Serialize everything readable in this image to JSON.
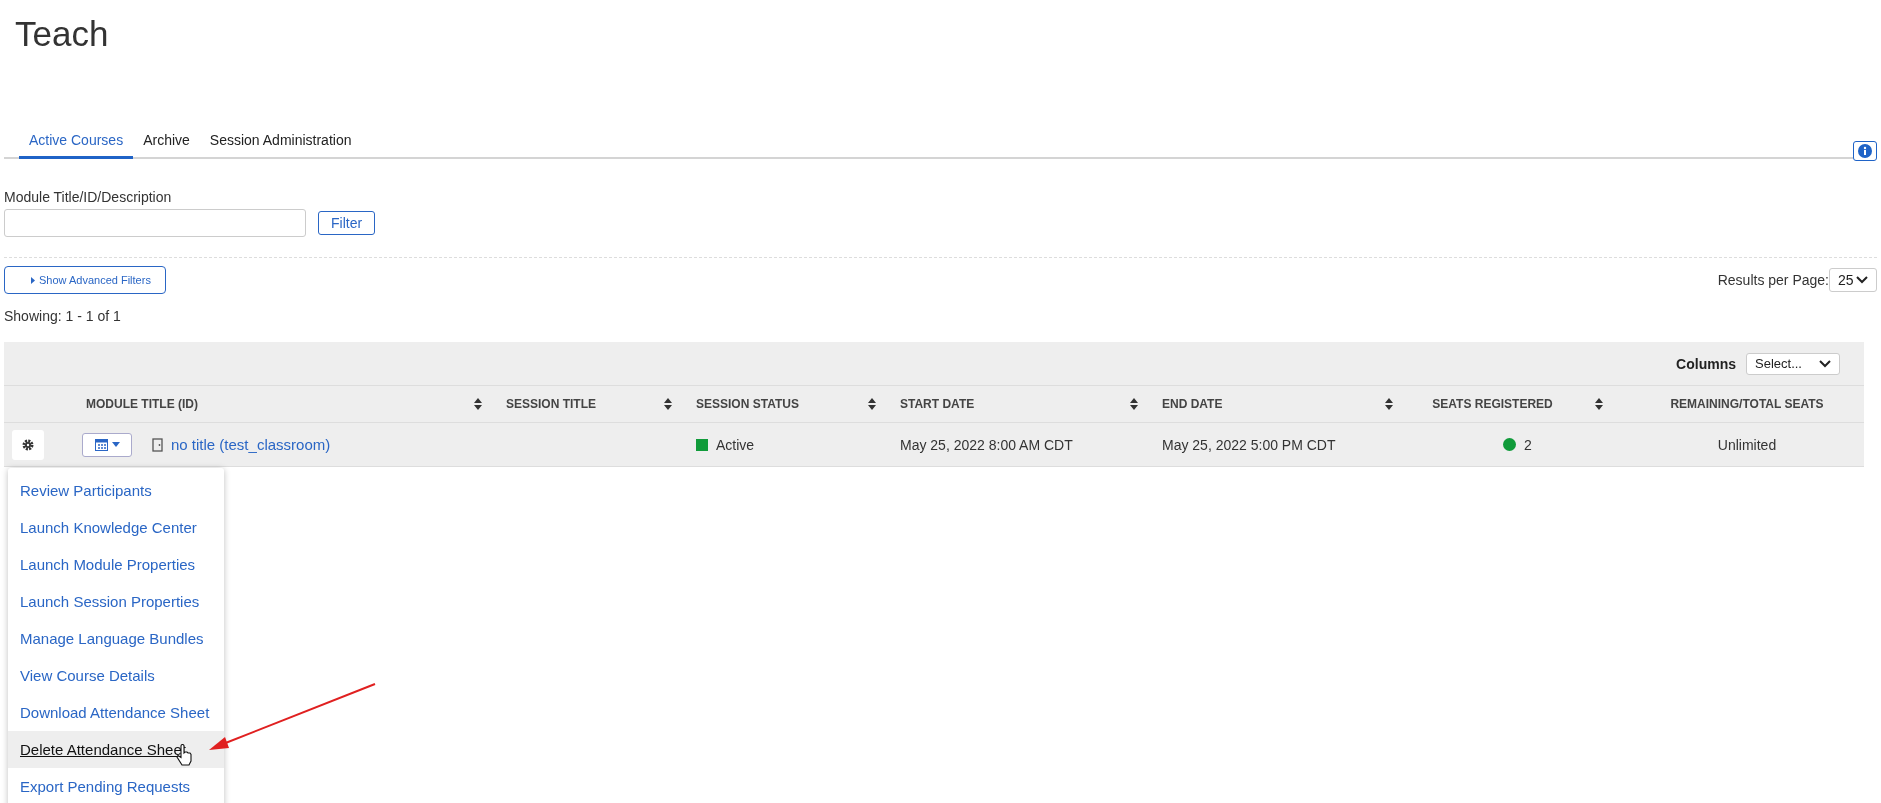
{
  "page": {
    "title": "Teach"
  },
  "tabs": [
    {
      "label": "Active Courses",
      "selected": true
    },
    {
      "label": "Archive",
      "selected": false
    },
    {
      "label": "Session Administration",
      "selected": false
    }
  ],
  "filter": {
    "label": "Module Title/ID/Description",
    "button": "Filter",
    "advanced_button": "Show Advanced Filters"
  },
  "results_per_page": {
    "label": "Results per Page:",
    "value": "25"
  },
  "showing": "Showing: 1 - 1 of 1",
  "table": {
    "columns_label": "Columns",
    "columns_select": "Select...",
    "columns": [
      {
        "label": "MODULE TITLE (ID)",
        "sortable": true
      },
      {
        "label": "SESSION TITLE",
        "sortable": true
      },
      {
        "label": "SESSION STATUS",
        "sortable": true
      },
      {
        "label": "START DATE",
        "sortable": true
      },
      {
        "label": "END DATE",
        "sortable": true
      },
      {
        "label": "SEATS REGISTERED",
        "sortable": true
      },
      {
        "label": "REMAINING/TOTAL SEATS",
        "sortable": false
      }
    ],
    "rows": [
      {
        "module_title": "no title (test_classroom)",
        "status": {
          "text": "Active",
          "color": "#109b3a"
        },
        "start_date": "May 25, 2022 8:00 AM CDT",
        "end_date": "May 25, 2022 5:00 PM CDT",
        "seats_registered": {
          "text": "2",
          "color": "#109b3a"
        },
        "remaining": "Unlimited"
      }
    ]
  },
  "action_menu": {
    "items": [
      {
        "label": "Review Participants",
        "hovered": false
      },
      {
        "label": "Launch Knowledge Center",
        "hovered": false
      },
      {
        "label": "Launch Module Properties",
        "hovered": false
      },
      {
        "label": "Launch Session Properties",
        "hovered": false
      },
      {
        "label": "Manage Language Bundles",
        "hovered": false
      },
      {
        "label": "View Course Details",
        "hovered": false
      },
      {
        "label": "Download Attendance Sheet",
        "hovered": false
      },
      {
        "label": "Delete Attendance Sheet",
        "hovered": true
      },
      {
        "label": "Export Pending Requests",
        "hovered": false
      }
    ]
  }
}
